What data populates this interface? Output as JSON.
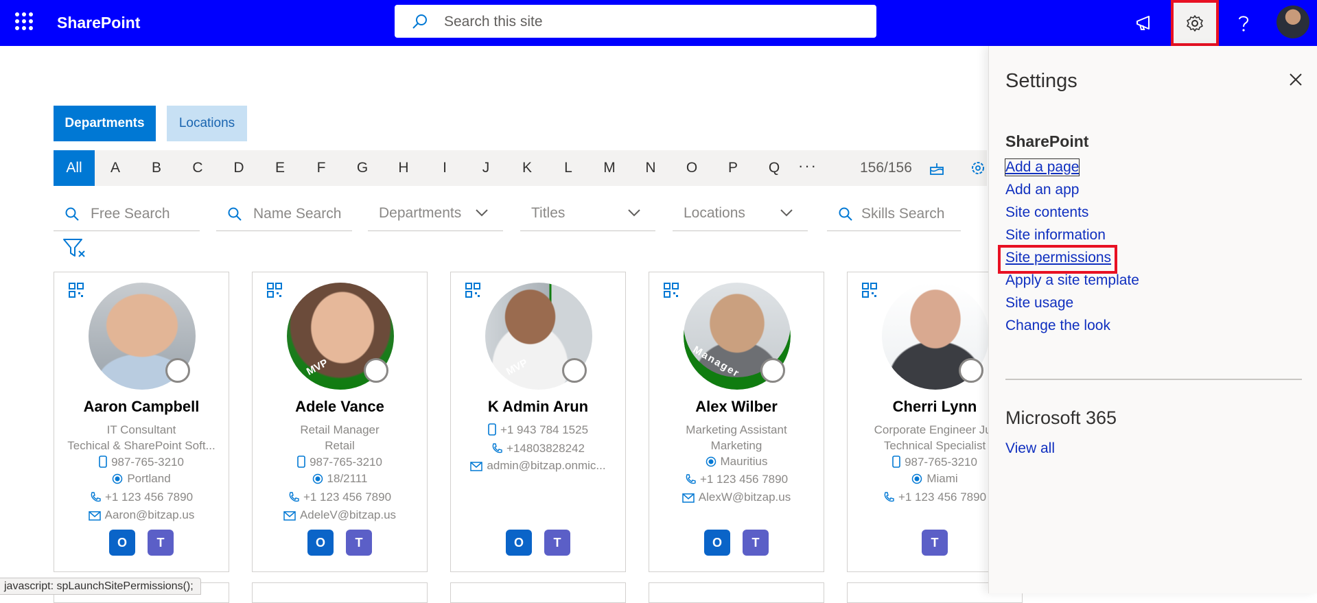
{
  "topbar": {
    "brand": "SharePoint",
    "search_placeholder": "Search this site",
    "color": "#0000ff"
  },
  "tabs": [
    {
      "label": "Departments",
      "active": true
    },
    {
      "label": "Locations",
      "active": false
    }
  ],
  "alphabet": {
    "all_label": "All",
    "letters": [
      "A",
      "B",
      "C",
      "D",
      "E",
      "F",
      "G",
      "H",
      "I",
      "J",
      "K",
      "L",
      "M",
      "N",
      "O",
      "P",
      "Q"
    ],
    "more": "···",
    "count": "156/156"
  },
  "filters": {
    "free_search": "Free Search",
    "name_search": "Name Search",
    "departments": "Departments",
    "titles": "Titles",
    "locations": "Locations",
    "skills_search": "Skills Search"
  },
  "cards": [
    {
      "name": "Aaron Campbell",
      "lines": [
        "IT Consultant",
        "Techical & SharePoint Soft...",
        "987-765-3210",
        "Portland",
        "+1 123 456 7890",
        "Aaron@bitzap.us"
      ],
      "badge": "",
      "apps": [
        "outlook",
        "teams"
      ]
    },
    {
      "name": "Adele Vance",
      "lines": [
        "Retail Manager",
        "Retail",
        "987-765-3210",
        "18/2111",
        "+1 123 456 7890",
        "AdeleV@bitzap.us"
      ],
      "badge": "MVP",
      "apps": [
        "outlook",
        "teams"
      ]
    },
    {
      "name": "K Admin Arun",
      "lines": [
        "+1 943 784 1525",
        "+14803828242",
        "admin@bitzap.onmic..."
      ],
      "badge": "MVP",
      "apps": [
        "outlook",
        "teams"
      ]
    },
    {
      "name": "Alex Wilber",
      "lines": [
        "Marketing Assistant",
        "Marketing",
        "Mauritius",
        "+1 123 456 7890",
        "AlexW@bitzap.us"
      ],
      "badge": "Manager",
      "apps": [
        "outlook",
        "teams"
      ]
    },
    {
      "name": "Cherri Lynn",
      "lines": [
        "Corporate Engineer Jur",
        "Technical Specialist",
        "987-765-3210",
        "Miami",
        "+1 123 456 7890"
      ],
      "badge": "",
      "apps": [
        "teams"
      ]
    }
  ],
  "settings": {
    "title": "Settings",
    "section_sharepoint": "SharePoint",
    "links": [
      "Add a page",
      "Add an app",
      "Site contents",
      "Site information",
      "Site permissions",
      "Apply a site template",
      "Site usage",
      "Change the look"
    ],
    "section_m365": "Microsoft 365",
    "view_all": "View all"
  },
  "status_bar": "javascript: spLaunchSitePermissions();",
  "colors": {
    "accent": "#0078d4",
    "highlight": "#e81123",
    "link": "#0f2fbf",
    "badge_green": "#107c10"
  }
}
